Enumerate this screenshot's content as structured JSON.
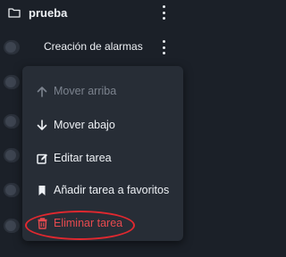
{
  "folder": {
    "title": "prueba"
  },
  "task": {
    "label": "Creación de alarmas"
  },
  "menu": {
    "items": [
      {
        "label": "Mover arriba",
        "icon": "arrow-up-icon",
        "state": "disabled"
      },
      {
        "label": "Mover abajo",
        "icon": "arrow-down-icon",
        "state": "normal"
      },
      {
        "label": "Editar tarea",
        "icon": "edit-icon",
        "state": "normal"
      },
      {
        "label": "Añadir tarea a favoritos",
        "icon": "bookmark-icon",
        "state": "normal"
      },
      {
        "label": "Eliminar tarea",
        "icon": "trash-icon",
        "state": "danger"
      }
    ]
  },
  "colors": {
    "background": "#1b2028",
    "menu": "#272d36",
    "danger": "#e64a4f",
    "highlight": "#e0282f"
  }
}
